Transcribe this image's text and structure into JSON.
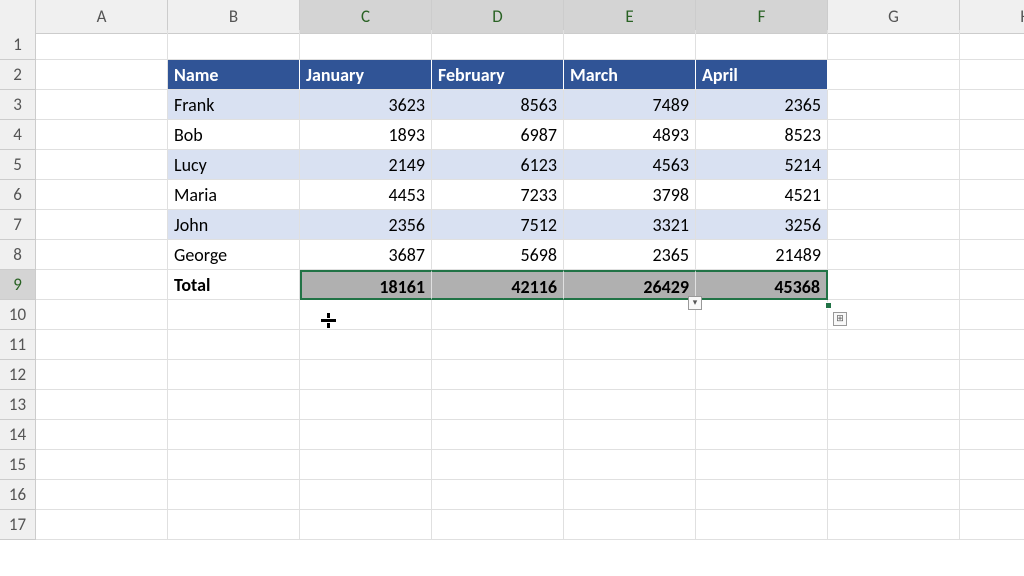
{
  "columns": [
    "A",
    "B",
    "C",
    "D",
    "E",
    "F",
    "G",
    "H"
  ],
  "rows": [
    "1",
    "2",
    "3",
    "4",
    "5",
    "6",
    "7",
    "8",
    "9",
    "10",
    "11",
    "12",
    "13",
    "14",
    "15",
    "16",
    "17"
  ],
  "selected_cols": [
    "C",
    "D",
    "E",
    "F"
  ],
  "selected_row": "9",
  "table": {
    "header": {
      "name": "Name",
      "jan": "January",
      "feb": "February",
      "mar": "March",
      "apr": "April"
    },
    "data": [
      {
        "name": "Frank",
        "jan": "3623",
        "feb": "8563",
        "mar": "7489",
        "apr": "2365"
      },
      {
        "name": "Bob",
        "jan": "1893",
        "feb": "6987",
        "mar": "4893",
        "apr": "8523"
      },
      {
        "name": "Lucy",
        "jan": "2149",
        "feb": "6123",
        "mar": "4563",
        "apr": "5214"
      },
      {
        "name": "Maria",
        "jan": "4453",
        "feb": "7233",
        "mar": "3798",
        "apr": "4521"
      },
      {
        "name": "John",
        "jan": "2356",
        "feb": "7512",
        "mar": "3321",
        "apr": "3256"
      },
      {
        "name": "George",
        "jan": "3687",
        "feb": "5698",
        "mar": "2365",
        "apr": "21489"
      }
    ],
    "total": {
      "label": "Total",
      "jan": "18161",
      "feb": "42116",
      "mar": "26429",
      "apr": "45368"
    }
  }
}
